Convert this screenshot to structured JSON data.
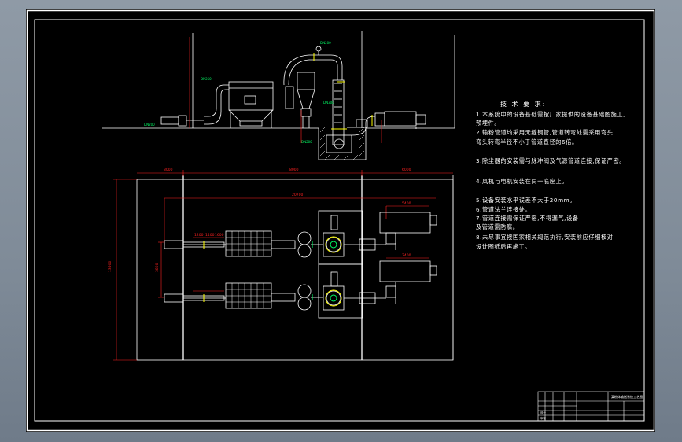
{
  "colors": {
    "background_gradient_top": "#8f9aa6",
    "sheet": "#000000",
    "line": "#ffffff",
    "dimension": "#ff2020",
    "pipe_label": "#00ff66",
    "flange": "#ffff00"
  },
  "notes": {
    "title": "技 术 要 求:",
    "items": [
      "1.本系统中的设备基础需按厂家提供的设备基础图施工,",
      "预埋件。",
      "2.输粉管道均采用无缝钢管,管道转弯处需采用弯头,",
      "弯头转弯半径不小于管道直径的6倍。",
      "3.除尘器的安装需与脉冲阀及气源管道连接,保证严密。",
      "4.风机与电机安装在同一底座上。",
      "5.设备安装水平误差不大于20mm。",
      "6.管道法兰连接处。",
      "7.管道连接需保证严密,不得漏气,设备",
      "及管道需防腐。",
      "8.未尽事宜按国家相关规范执行,安装前应仔细核对",
      "设计图纸后再施工。"
    ]
  },
  "elevation_labels": [
    "DN250",
    "DN200",
    "DN300",
    "DN200",
    "DN200"
  ],
  "plan_dims": {
    "top": [
      "3000",
      "8000",
      "6000"
    ],
    "overall": "20700",
    "left": "13500",
    "left_inner": "3800",
    "small": [
      "1200",
      "1400",
      "1600",
      "5400",
      "2400"
    ]
  },
  "title_block": {
    "drawing_name": "某粉体输送系统工艺图",
    "rows": [
      "设计",
      "审核"
    ]
  }
}
